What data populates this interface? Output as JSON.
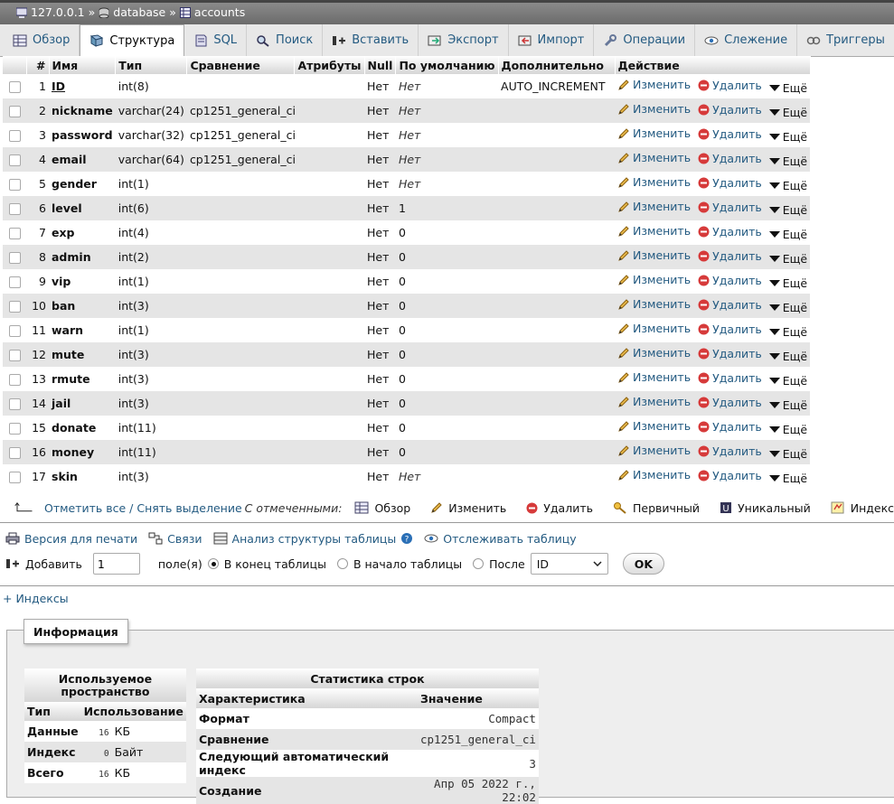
{
  "breadcrumb": {
    "server": "127.0.0.1",
    "database": "database",
    "table": "accounts",
    "sep": "»"
  },
  "tabs": [
    {
      "label": "Обзор",
      "icon": "browse-icon"
    },
    {
      "label": "Структура",
      "icon": "structure-icon",
      "active": true
    },
    {
      "label": "SQL",
      "icon": "sql-icon"
    },
    {
      "label": "Поиск",
      "icon": "search-icon"
    },
    {
      "label": "Вставить",
      "icon": "insert-icon"
    },
    {
      "label": "Экспорт",
      "icon": "export-icon"
    },
    {
      "label": "Импорт",
      "icon": "import-icon"
    },
    {
      "label": "Операции",
      "icon": "wrench-icon"
    },
    {
      "label": "Слежение",
      "icon": "eye-icon"
    },
    {
      "label": "Триггеры",
      "icon": "triggers-icon"
    }
  ],
  "columns": [
    "#",
    "Имя",
    "Тип",
    "Сравнение",
    "Атрибуты",
    "Null",
    "По умолчанию",
    "Дополнительно",
    "Действие"
  ],
  "actions": {
    "edit": "Изменить",
    "delete": "Удалить",
    "more": "Ещё"
  },
  "fields": [
    {
      "num": "1",
      "name": "ID",
      "type": "int(8)",
      "collation": "",
      "attr": "",
      "null": "Нет",
      "default": "Нет",
      "default_italic": true,
      "extra": "AUTO_INCREMENT"
    },
    {
      "num": "2",
      "name": "nickname",
      "type": "varchar(24)",
      "collation": "cp1251_general_ci",
      "attr": "",
      "null": "Нет",
      "default": "Нет",
      "default_italic": true,
      "extra": ""
    },
    {
      "num": "3",
      "name": "password",
      "type": "varchar(32)",
      "collation": "cp1251_general_ci",
      "attr": "",
      "null": "Нет",
      "default": "Нет",
      "default_italic": true,
      "extra": ""
    },
    {
      "num": "4",
      "name": "email",
      "type": "varchar(64)",
      "collation": "cp1251_general_ci",
      "attr": "",
      "null": "Нет",
      "default": "Нет",
      "default_italic": true,
      "extra": ""
    },
    {
      "num": "5",
      "name": "gender",
      "type": "int(1)",
      "collation": "",
      "attr": "",
      "null": "Нет",
      "default": "Нет",
      "default_italic": true,
      "extra": ""
    },
    {
      "num": "6",
      "name": "level",
      "type": "int(6)",
      "collation": "",
      "attr": "",
      "null": "Нет",
      "default": "1",
      "default_italic": false,
      "extra": ""
    },
    {
      "num": "7",
      "name": "exp",
      "type": "int(4)",
      "collation": "",
      "attr": "",
      "null": "Нет",
      "default": "0",
      "default_italic": false,
      "extra": ""
    },
    {
      "num": "8",
      "name": "admin",
      "type": "int(2)",
      "collation": "",
      "attr": "",
      "null": "Нет",
      "default": "0",
      "default_italic": false,
      "extra": ""
    },
    {
      "num": "9",
      "name": "vip",
      "type": "int(1)",
      "collation": "",
      "attr": "",
      "null": "Нет",
      "default": "0",
      "default_italic": false,
      "extra": ""
    },
    {
      "num": "10",
      "name": "ban",
      "type": "int(3)",
      "collation": "",
      "attr": "",
      "null": "Нет",
      "default": "0",
      "default_italic": false,
      "extra": ""
    },
    {
      "num": "11",
      "name": "warn",
      "type": "int(1)",
      "collation": "",
      "attr": "",
      "null": "Нет",
      "default": "0",
      "default_italic": false,
      "extra": ""
    },
    {
      "num": "12",
      "name": "mute",
      "type": "int(3)",
      "collation": "",
      "attr": "",
      "null": "Нет",
      "default": "0",
      "default_italic": false,
      "extra": ""
    },
    {
      "num": "13",
      "name": "rmute",
      "type": "int(3)",
      "collation": "",
      "attr": "",
      "null": "Нет",
      "default": "0",
      "default_italic": false,
      "extra": ""
    },
    {
      "num": "14",
      "name": "jail",
      "type": "int(3)",
      "collation": "",
      "attr": "",
      "null": "Нет",
      "default": "0",
      "default_italic": false,
      "extra": ""
    },
    {
      "num": "15",
      "name": "donate",
      "type": "int(11)",
      "collation": "",
      "attr": "",
      "null": "Нет",
      "default": "0",
      "default_italic": false,
      "extra": ""
    },
    {
      "num": "16",
      "name": "money",
      "type": "int(11)",
      "collation": "",
      "attr": "",
      "null": "Нет",
      "default": "0",
      "default_italic": false,
      "extra": ""
    },
    {
      "num": "17",
      "name": "skin",
      "type": "int(3)",
      "collation": "",
      "attr": "",
      "null": "Нет",
      "default": "Нет",
      "default_italic": true,
      "extra": ""
    }
  ],
  "with_selected": {
    "select_all": "Отметить все / Снять выделение",
    "label": "С отмеченными:",
    "buttons": [
      {
        "label": "Обзор",
        "icon": "browse-icon"
      },
      {
        "label": "Изменить",
        "icon": "pencil-icon"
      },
      {
        "label": "Удалить",
        "icon": "delete-icon"
      },
      {
        "label": "Первичный",
        "icon": "primary-key-icon"
      },
      {
        "label": "Уникальный",
        "icon": "unique-icon"
      },
      {
        "label": "Индекс",
        "icon": "index-icon"
      }
    ]
  },
  "print_bar": {
    "print": "Версия для печати",
    "relations": "Связи",
    "analyze": "Анализ структуры таблицы",
    "track": "Отслеживать таблицу"
  },
  "add_row": {
    "label": "Добавить",
    "count": "1",
    "fields_label": "поле(я)",
    "at_end": "В конец таблицы",
    "at_start": "В начало таблицы",
    "after": "После",
    "after_field": "ID",
    "ok": "OK"
  },
  "indexes_link": "+ Индексы",
  "info": {
    "legend": "Информация",
    "space": {
      "title_line1": "Используемое",
      "title_line2": "пространство",
      "col_type": "Тип",
      "col_usage": "Использование",
      "rows": [
        {
          "type": "Данные",
          "value": "16",
          "unit": "КБ"
        },
        {
          "type": "Индекс",
          "value": "0",
          "unit": "Байт"
        },
        {
          "type": "Всего",
          "value": "16",
          "unit": "КБ"
        }
      ]
    },
    "stats": {
      "title": "Статистика строк",
      "col_prop": "Характеристика",
      "col_value": "Значение",
      "rows": [
        {
          "prop": "Формат",
          "value": "Compact"
        },
        {
          "prop": "Сравнение",
          "value": "cp1251_general_ci"
        },
        {
          "prop": "Следующий автоматический индекс",
          "value": "3"
        },
        {
          "prop": "Создание",
          "value": "Апр 05 2022 г., 22:02"
        }
      ]
    }
  }
}
